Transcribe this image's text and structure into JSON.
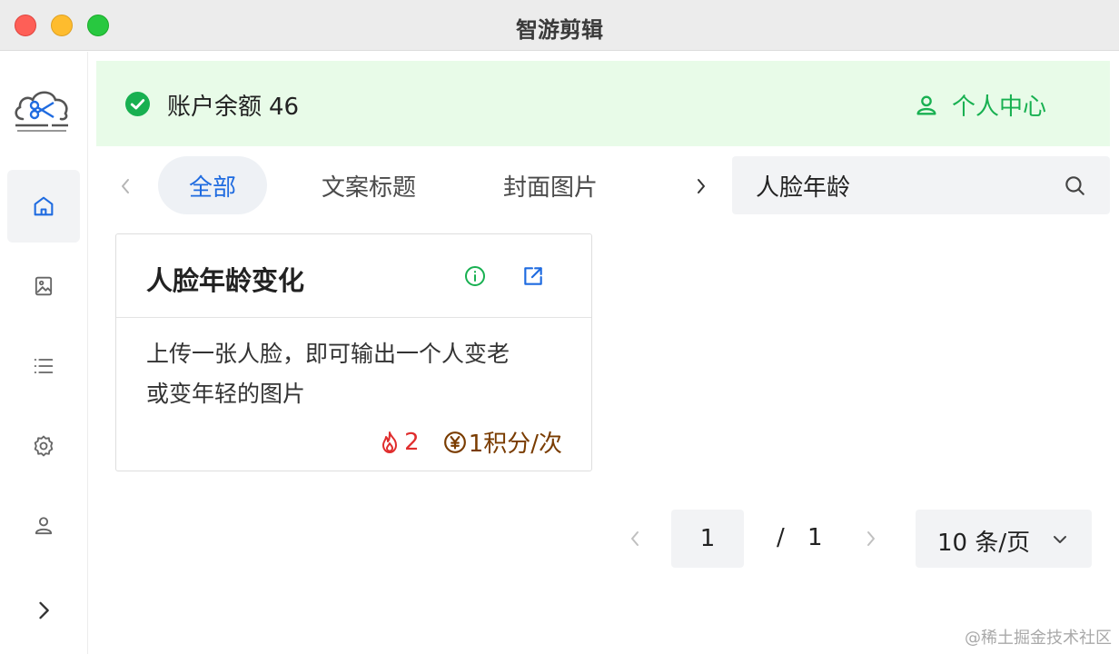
{
  "window": {
    "title": "智游剪辑"
  },
  "sidebar": {
    "logo": "cloud-scissors-logo",
    "items": [
      {
        "icon": "home-icon",
        "active": true
      },
      {
        "icon": "image-icon",
        "active": false
      },
      {
        "icon": "list-icon",
        "active": false
      },
      {
        "icon": "gear-icon",
        "active": false
      },
      {
        "icon": "user-icon",
        "active": false
      }
    ],
    "expand_icon": "chevron-right-icon"
  },
  "banner": {
    "balance_label": "账户余额",
    "balance_value": "46",
    "profile_label": "个人中心",
    "color": "#18b051"
  },
  "tabs": {
    "items": [
      {
        "label": "全部",
        "active": true
      },
      {
        "label": "文案标题",
        "active": false
      },
      {
        "label": "封面图片",
        "active": false
      }
    ]
  },
  "search": {
    "value": "人脸年龄"
  },
  "cards": [
    {
      "title": "人脸年龄变化",
      "description_line1": "上传一张人脸，即可输出一个人变老",
      "description_line2": "或变年轻的图片",
      "hot_count": "2",
      "cost": "1积分/次"
    }
  ],
  "pagination": {
    "current": "1",
    "separator": "/",
    "total": "1",
    "page_size": "10 条/页"
  },
  "watermark": "@稀土掘金技术社区",
  "colors": {
    "accent_blue": "#1f6be0",
    "hot_red": "#e02d2d",
    "cost_brown": "#7a3c00"
  }
}
